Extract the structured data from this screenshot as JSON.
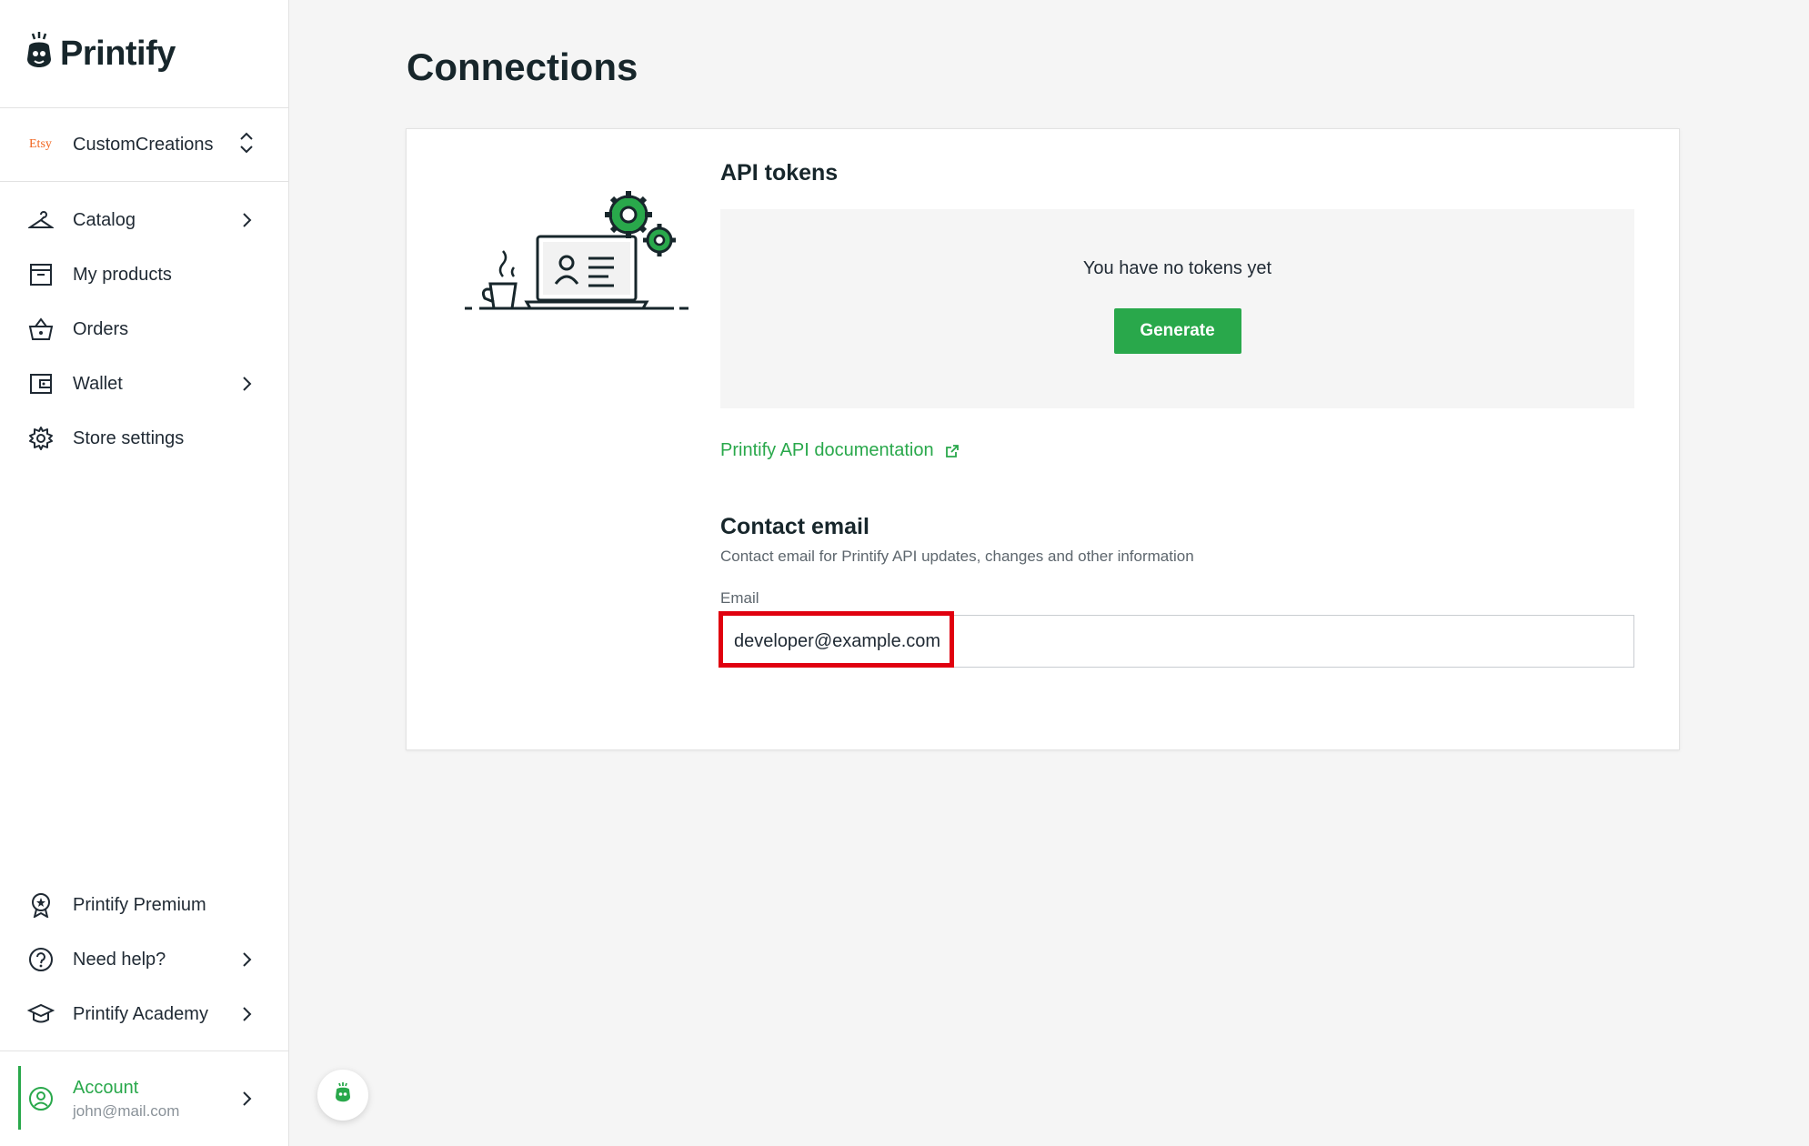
{
  "brand": {
    "name": "Printify",
    "accent": "#29a84b"
  },
  "store": {
    "badge": "Etsy",
    "name": "CustomCreations"
  },
  "nav": {
    "items": [
      {
        "label": "Catalog",
        "icon": "hanger-icon",
        "has_chevron": true
      },
      {
        "label": "My products",
        "icon": "archive-box-icon",
        "has_chevron": false
      },
      {
        "label": "Orders",
        "icon": "basket-icon",
        "has_chevron": false
      },
      {
        "label": "Wallet",
        "icon": "wallet-icon",
        "has_chevron": true
      },
      {
        "label": "Store settings",
        "icon": "gear-icon",
        "has_chevron": false
      }
    ],
    "bottom_items": [
      {
        "label": "Printify Premium",
        "icon": "premium-badge-icon",
        "has_chevron": false
      },
      {
        "label": "Need help?",
        "icon": "help-circle-icon",
        "has_chevron": true
      },
      {
        "label": "Printify Academy",
        "icon": "graduation-cap-icon",
        "has_chevron": true
      }
    ]
  },
  "account": {
    "label": "Account",
    "email": "john@mail.com"
  },
  "page": {
    "title": "Connections"
  },
  "api_tokens": {
    "title": "API tokens",
    "empty_text": "You have no tokens yet",
    "generate_label": "Generate",
    "doc_link": "Printify API documentation"
  },
  "contact": {
    "title": "Contact email",
    "description": "Contact email for Printify API updates, changes and other information",
    "email_label": "Email",
    "email_value": "developer@example.com"
  }
}
